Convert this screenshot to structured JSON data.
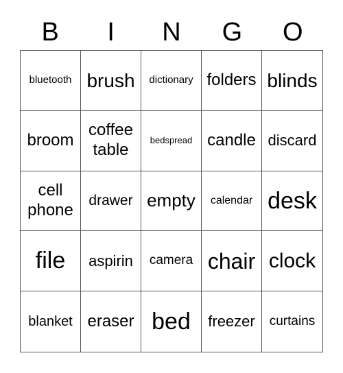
{
  "header": [
    "B",
    "I",
    "N",
    "G",
    "O"
  ],
  "cells": [
    {
      "text": "bluetooth",
      "size": 15
    },
    {
      "text": "brush",
      "size": 28
    },
    {
      "text": "dictionary",
      "size": 15
    },
    {
      "text": "folders",
      "size": 24
    },
    {
      "text": "blinds",
      "size": 28
    },
    {
      "text": "broom",
      "size": 24
    },
    {
      "text": "coffee table",
      "size": 24
    },
    {
      "text": "bedspread",
      "size": 13
    },
    {
      "text": "candle",
      "size": 24
    },
    {
      "text": "discard",
      "size": 22
    },
    {
      "text": "cell phone",
      "size": 24
    },
    {
      "text": "drawer",
      "size": 21
    },
    {
      "text": "empty",
      "size": 26
    },
    {
      "text": "calendar",
      "size": 16
    },
    {
      "text": "desk",
      "size": 34
    },
    {
      "text": "file",
      "size": 34
    },
    {
      "text": "aspirin",
      "size": 22
    },
    {
      "text": "camera",
      "size": 19
    },
    {
      "text": "chair",
      "size": 32
    },
    {
      "text": "clock",
      "size": 30
    },
    {
      "text": "blanket",
      "size": 20
    },
    {
      "text": "eraser",
      "size": 24
    },
    {
      "text": "bed",
      "size": 34
    },
    {
      "text": "freezer",
      "size": 22
    },
    {
      "text": "curtains",
      "size": 19
    }
  ]
}
